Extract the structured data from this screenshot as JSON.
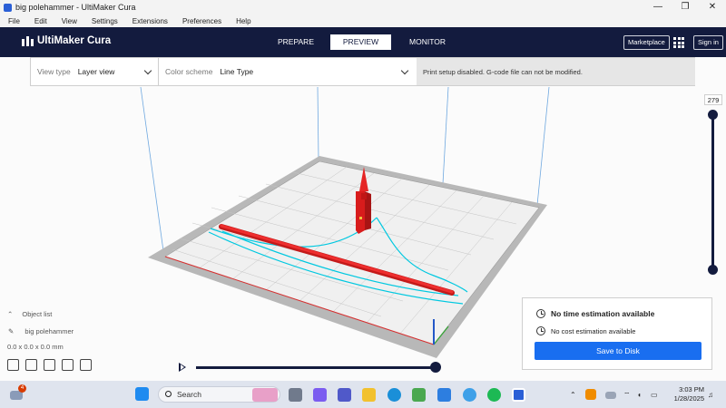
{
  "window": {
    "title": "big polehammer - UltiMaker Cura",
    "controls": [
      "—",
      "❐",
      "✕"
    ]
  },
  "menu": [
    "File",
    "Edit",
    "View",
    "Settings",
    "Extensions",
    "Preferences",
    "Help"
  ],
  "header": {
    "brand": "UltiMaker Cura",
    "tabs": [
      {
        "label": "PREPARE",
        "active": false
      },
      {
        "label": "PREVIEW",
        "active": true
      },
      {
        "label": "MONITOR",
        "active": false
      }
    ],
    "marketplace": "Marketplace",
    "sign_in": "Sign in"
  },
  "toolbar": {
    "view_type_label": "View type",
    "view_type_value": "Layer view",
    "color_scheme_label": "Color scheme",
    "color_scheme_value": "Line Type",
    "message": "Print setup disabled. G-code file can not be modified."
  },
  "layer_slider": {
    "current_layer": "279",
    "max_layer": 279,
    "min_layer": 1
  },
  "object_list": {
    "heading": "Object list",
    "object_name": "big polehammer",
    "dimensions": "0.0 x 0.0 x 0.0 mm"
  },
  "simulation": {
    "progress": 1.0
  },
  "estimate": {
    "time": "No time estimation available",
    "cost": "No cost estimation available",
    "save_button": "Save to Disk"
  },
  "taskbar": {
    "notification_count": "4",
    "search_placeholder": "Search",
    "time": "3:03 PM",
    "date": "1/28/2025",
    "colors": {
      "accent": "#131b3e",
      "button": "#196ef0",
      "print_red": "#e21d1d",
      "travel_cyan": "#00c8e0"
    }
  }
}
